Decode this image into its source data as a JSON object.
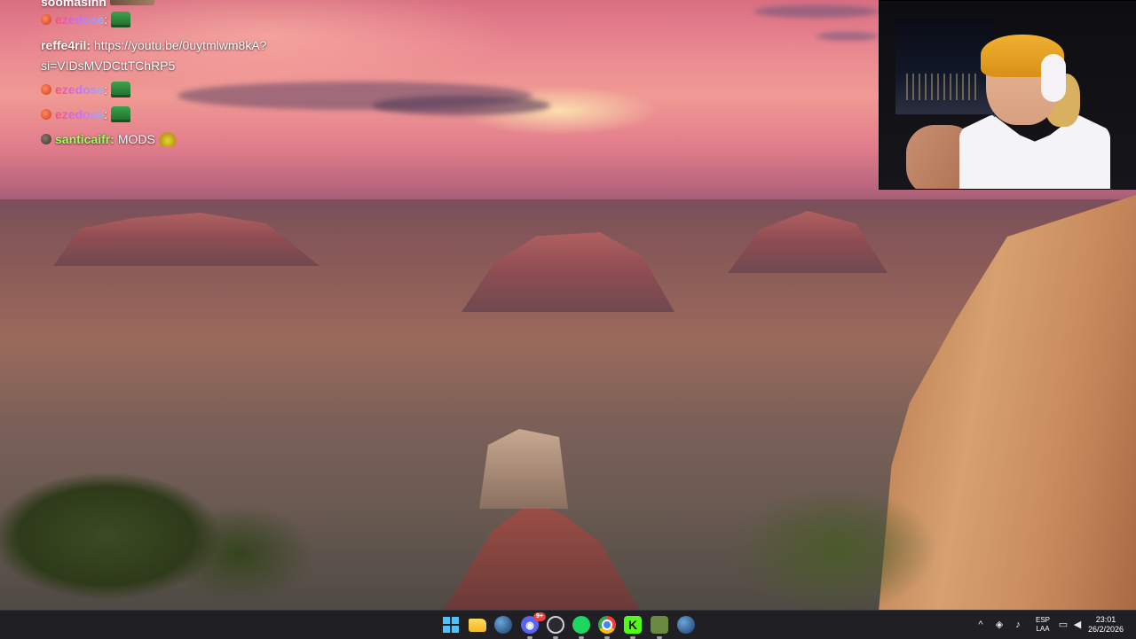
{
  "chat": {
    "cutoff_top_user": "soomasinn",
    "messages": [
      {
        "badge": "red",
        "user": "ezedose",
        "user_style": "rainbow",
        "text": "",
        "emote": "green-emote"
      },
      {
        "badge": "none",
        "user": "reffe4ril:",
        "user_style": "white",
        "text": "https://youtu.be/0uytmlwm8kA?",
        "continuation": "si=VIDsMVDCttTChRP5"
      },
      {
        "badge": "red",
        "user": "ezedose",
        "user_style": "rainbow",
        "text": "",
        "emote": "green-emote"
      },
      {
        "badge": "red",
        "user": "ezedose",
        "user_style": "rainbow",
        "text": "",
        "emote": "green-emote"
      },
      {
        "badge": "dark",
        "user": "santicaifr:",
        "user_style": "green",
        "text": "MODS",
        "emote": "duck-emote"
      }
    ]
  },
  "webcam": {
    "label": "streamer webcam"
  },
  "taskbar": {
    "apps": [
      {
        "name": "start",
        "icon": "windows-icon"
      },
      {
        "name": "file-explorer",
        "icon": "folder-icon"
      },
      {
        "name": "steam",
        "icon": "steam-icon"
      },
      {
        "name": "discord",
        "icon": "discord-icon",
        "badge": "9+"
      },
      {
        "name": "obs",
        "icon": "obs-icon"
      },
      {
        "name": "spotify",
        "icon": "spotify-icon"
      },
      {
        "name": "chrome",
        "icon": "chrome-icon"
      },
      {
        "name": "kick",
        "icon": "kick-icon",
        "glyph": "K"
      },
      {
        "name": "game",
        "icon": "game-icon"
      },
      {
        "name": "steam-2",
        "icon": "steam-icon"
      }
    ],
    "tray": {
      "overflow": "^",
      "language_top": "ESP",
      "language_bottom": "LAA",
      "time": "23:01",
      "date": "26/2/2026"
    }
  },
  "colors": {
    "taskbar_bg": "#202024",
    "chat_user_green": "#9cff5c",
    "windows_accent": "#4cc2ff",
    "kick_green": "#53fc18"
  }
}
